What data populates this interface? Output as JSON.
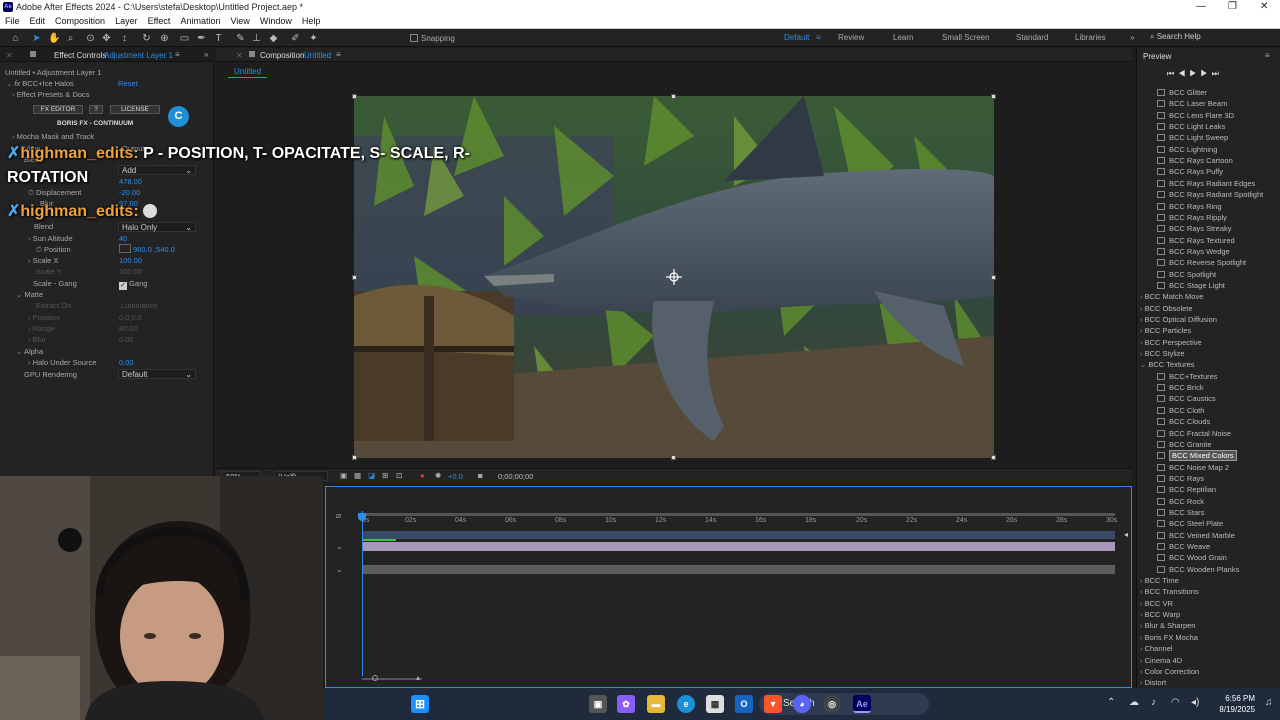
{
  "window": {
    "title": "Adobe After Effects 2024 - C:\\Users\\stefa\\Desktop\\Untitled Project.aep *",
    "app_badge": "Ae"
  },
  "menu": [
    "File",
    "Edit",
    "Composition",
    "Layer",
    "Effect",
    "Animation",
    "View",
    "Window",
    "Help"
  ],
  "toolbar": {
    "snapping": "Snapping",
    "search_help": "Search Help"
  },
  "workspaces": [
    "Default",
    "Review",
    "Learn",
    "Small Screen",
    "Standard",
    "Libraries"
  ],
  "effect_controls": {
    "tab": "Effect Controls",
    "tab_layer": "Adjustment Layer 1",
    "layer_path": "Untitled • Adjustment Layer 1",
    "effect_name": "BCC+Ice Halos",
    "reset": "Reset",
    "presets": "Effect Presets & Docs",
    "fx_editor": "FX EDITOR",
    "help_q": "?",
    "license": "LICENSE",
    "brand": "BORIS FX - CONTINUUM",
    "brand_logo": "C",
    "mocha": "Mocha Mask and Track",
    "view_label": "View",
    "view_value": "Output",
    "blend_label": "Blend",
    "blend_value": "Add",
    "v1_value": "478.00",
    "displacement_label": "Displacement",
    "displacement_value": "-20.00",
    "blur_label": "Blur",
    "blur_value": "97.00",
    "blend2_label": "Blend",
    "blend2_value": "Halo Only",
    "sun_alt_label": "Sun Altitude",
    "sun_alt_value": "40",
    "position_label": "Position",
    "position_value": "960.0 ,540.0",
    "scalex_label": "Scale X",
    "scalex_value": "100.00",
    "scaley_label": "Scale Y",
    "scaley_value": "100.00",
    "scale_gang_label": "Scale - Gang",
    "gang": "Gang",
    "matte": "Matte",
    "extract_label": "Extract On",
    "extract_value": "Luminance",
    "m_position": "Position",
    "m_position_value": "0.0,0.0",
    "m_range": "Range",
    "m_range_value": "80.00",
    "m_blur": "Blur",
    "m_blur_value": "0.00",
    "alpha": "Alpha",
    "halo_under_label": "Halo Under Source",
    "halo_under_value": "0.00",
    "gpu_label": "GPU Rendering",
    "gpu_value": "Default"
  },
  "composition": {
    "tab": "Composition",
    "tab_name": "Untitled",
    "sub_tab": "Untitled",
    "zoom": "50%",
    "resolution": "(Half)",
    "exposure": "+0.0",
    "timecode": "0;00;00;00"
  },
  "timeline": {
    "ticks": [
      "0s",
      "02s",
      "04s",
      "06s",
      "08s",
      "10s",
      "12s",
      "14s",
      "16s",
      "18s",
      "20s",
      "22s",
      "24s",
      "26s",
      "28s",
      "30s"
    ]
  },
  "effects_presets": {
    "tab": "Preview",
    "items": [
      {
        "label": "BCC Glitter",
        "kind": "effect"
      },
      {
        "label": "BCC Laser Beam",
        "kind": "effect"
      },
      {
        "label": "BCC Lens Flare 3D",
        "kind": "effect"
      },
      {
        "label": "BCC Light Leaks",
        "kind": "effect"
      },
      {
        "label": "BCC Light Sweep",
        "kind": "effect"
      },
      {
        "label": "BCC Lightning",
        "kind": "effect"
      },
      {
        "label": "BCC Rays Cartoon",
        "kind": "effect"
      },
      {
        "label": "BCC Rays Puffy",
        "kind": "effect"
      },
      {
        "label": "BCC Rays Radiant Edges",
        "kind": "effect"
      },
      {
        "label": "BCC Rays Radiant Spotlight",
        "kind": "effect"
      },
      {
        "label": "BCC Rays Ring",
        "kind": "effect"
      },
      {
        "label": "BCC Rays Ripply",
        "kind": "effect"
      },
      {
        "label": "BCC Rays Streaky",
        "kind": "effect"
      },
      {
        "label": "BCC Rays Textured",
        "kind": "effect"
      },
      {
        "label": "BCC Rays Wedge",
        "kind": "effect"
      },
      {
        "label": "BCC Reverse Spotlight",
        "kind": "effect"
      },
      {
        "label": "BCC Spotlight",
        "kind": "effect"
      },
      {
        "label": "BCC Stage Light",
        "kind": "effect"
      },
      {
        "label": "BCC Match Move",
        "kind": "group"
      },
      {
        "label": "BCC Obsolete",
        "kind": "group"
      },
      {
        "label": "BCC Optical Diffusion",
        "kind": "group"
      },
      {
        "label": "BCC Particles",
        "kind": "group"
      },
      {
        "label": "BCC Perspective",
        "kind": "group"
      },
      {
        "label": "BCC Stylize",
        "kind": "group"
      },
      {
        "label": "BCC Textures",
        "kind": "group-open"
      },
      {
        "label": "BCC+Textures",
        "kind": "effect"
      },
      {
        "label": "BCC Brick",
        "kind": "effect"
      },
      {
        "label": "BCC Caustics",
        "kind": "effect"
      },
      {
        "label": "BCC Cloth",
        "kind": "effect"
      },
      {
        "label": "BCC Clouds",
        "kind": "effect"
      },
      {
        "label": "BCC Fractal Noise",
        "kind": "effect"
      },
      {
        "label": "BCC Granite",
        "kind": "effect"
      },
      {
        "label": "BCC Mixed Colors",
        "kind": "selected"
      },
      {
        "label": "BCC Noise Map 2",
        "kind": "effect"
      },
      {
        "label": "BCC Rays",
        "kind": "effect"
      },
      {
        "label": "BCC Reptilian",
        "kind": "effect"
      },
      {
        "label": "BCC Rock",
        "kind": "effect"
      },
      {
        "label": "BCC Stars",
        "kind": "effect"
      },
      {
        "label": "BCC Steel Plate",
        "kind": "effect"
      },
      {
        "label": "BCC Veined Marble",
        "kind": "effect"
      },
      {
        "label": "BCC Weave",
        "kind": "effect"
      },
      {
        "label": "BCC Wood Grain",
        "kind": "effect"
      },
      {
        "label": "BCC Wooden Planks",
        "kind": "effect"
      },
      {
        "label": "BCC Time",
        "kind": "group"
      },
      {
        "label": "BCC Transitions",
        "kind": "group"
      },
      {
        "label": "BCC VR",
        "kind": "group"
      },
      {
        "label": "BCC Warp",
        "kind": "group"
      },
      {
        "label": "Blur & Sharpen",
        "kind": "group"
      },
      {
        "label": "Boris FX Mocha",
        "kind": "group"
      },
      {
        "label": "Channel",
        "kind": "group"
      },
      {
        "label": "Cinema 4D",
        "kind": "group"
      },
      {
        "label": "Color Correction",
        "kind": "group"
      },
      {
        "label": "Distort",
        "kind": "group"
      }
    ]
  },
  "chat": {
    "msg1_user": "highman_edits:",
    "msg1_text": "P - POSITION, T- OPACITATE, S- SCALE, R-",
    "msg1_text2": "ROTATION",
    "msg2_user": "highman_edits:"
  },
  "taskbar": {
    "search": "Search",
    "time": "6:56 PM",
    "date": "8/19/2025"
  },
  "colors": {
    "accent": "#2d8ceb",
    "chat_user": "#f0a23a"
  }
}
